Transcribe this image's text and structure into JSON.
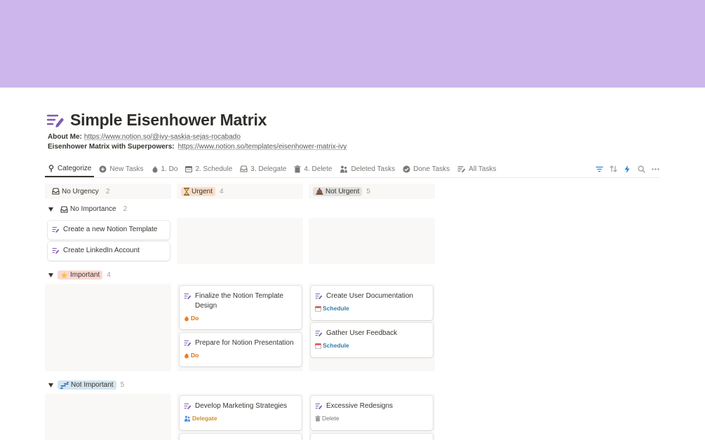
{
  "cover": {
    "color": "#cdb6ec"
  },
  "page": {
    "title": "Simple Eisenhower Matrix",
    "title_icon": "pen-list-icon"
  },
  "meta": [
    {
      "label": "About Me:",
      "link": "https://www.notion.so/@ivy-saskia-sejas-rocabado"
    },
    {
      "label": "Eisenhower Matrix with Superpowers:",
      "link": "https://www.notion.so/templates/eisenhower-matrix-ivy"
    }
  ],
  "tabs": [
    {
      "label": "Categorize",
      "icon": "pin-icon"
    },
    {
      "label": "New Tasks",
      "icon": "plus-circle-icon"
    },
    {
      "label": "1. Do",
      "icon": "fire-icon"
    },
    {
      "label": "2. Schedule",
      "icon": "calendar-icon"
    },
    {
      "label": "3. Delegate",
      "icon": "inbox-icon"
    },
    {
      "label": "4. Delete",
      "icon": "trash-icon"
    },
    {
      "label": "Deleted Tasks",
      "icon": "people-icon"
    },
    {
      "label": "Done Tasks",
      "icon": "check-circle-icon"
    },
    {
      "label": "All Tasks",
      "icon": "list-icon"
    }
  ],
  "columns": [
    {
      "label": "No Urgency",
      "count": "2",
      "tag_bg": "",
      "icon": "inbox-icon"
    },
    {
      "label": "Urgent",
      "count": "4",
      "tag_bg": "#fadec9",
      "icon": "hourglass-icon"
    },
    {
      "label": "Not Urgent",
      "count": "5",
      "tag_bg": "#e3e2e0",
      "icon": "alarm-icon"
    }
  ],
  "groups": [
    {
      "label": "No Importance",
      "count": "2",
      "tag_bg": "",
      "icon": "inbox-icon"
    },
    {
      "label": "Important",
      "count": "4",
      "tag_bg": "#fbd8d3",
      "icon": "star-icon"
    },
    {
      "label": "Not Important",
      "count": "5",
      "tag_bg": "#d3e5ef",
      "icon": "zzz-icon"
    }
  ],
  "cards": {
    "c1": {
      "title": "Create a new Notion Template"
    },
    "c2": {
      "title": "Create LinkedIn Account"
    },
    "c3": {
      "title_1": "Finalize the Notion Template",
      "title_2": "Design",
      "status": "Do",
      "status_color": "#d9730d",
      "status_icon": "fire-icon"
    },
    "c4": {
      "title": "Prepare for Notion Presentation",
      "status": "Do",
      "status_color": "#d9730d",
      "status_icon": "fire-icon"
    },
    "c5": {
      "title": "Create User Documentation",
      "status": "Schedule",
      "status_color": "#337ea9",
      "status_icon": "calendar-icon"
    },
    "c6": {
      "title": "Gather User Feedback",
      "status": "Schedule",
      "status_color": "#337ea9",
      "status_icon": "calendar-icon"
    },
    "c7": {
      "title": "Develop Marketing Strategies",
      "status": "Delegate",
      "status_color": "#cb912f",
      "status_icon": "people-icon"
    },
    "c8": {
      "title": "Excessive Redesigns",
      "status": "Delete",
      "status_color": "#787774",
      "status_icon": "trash-icon"
    }
  }
}
